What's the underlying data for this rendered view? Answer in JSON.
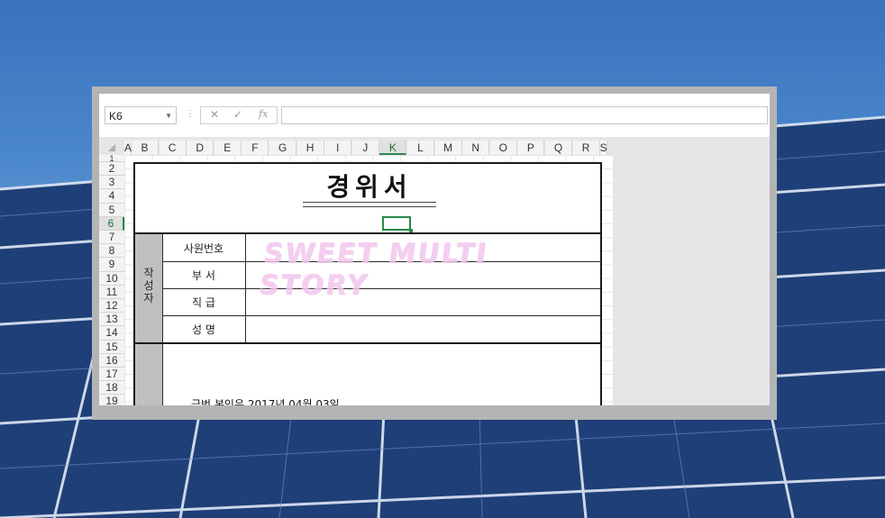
{
  "excel": {
    "name_box": "K6",
    "fx_symbol": "fx",
    "cancel_symbol": "✕",
    "enter_symbol": "✓",
    "formula": ""
  },
  "columns": [
    "A",
    "B",
    "C",
    "D",
    "E",
    "F",
    "G",
    "H",
    "I",
    "J",
    "K",
    "L",
    "M",
    "N",
    "O",
    "P",
    "Q",
    "R",
    "S"
  ],
  "selected_column": "K",
  "rows": [
    "1",
    "2",
    "3",
    "4",
    "5",
    "6",
    "7",
    "8",
    "9",
    "10",
    "11",
    "12",
    "13",
    "14",
    "15",
    "16",
    "17",
    "18",
    "19"
  ],
  "selected_row": "6",
  "form": {
    "title": "경위서",
    "author_label": "작성자",
    "fields": [
      "사원번호",
      "부 서",
      "직 급",
      "성 명"
    ],
    "body_text": "금번 본인은 2017년 04월 03일"
  },
  "watermark": "SWEET MULTI STORY"
}
